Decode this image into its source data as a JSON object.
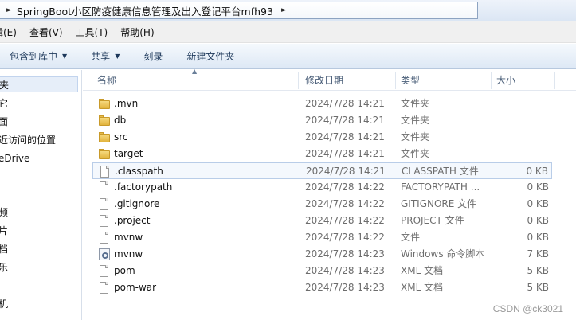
{
  "address": {
    "path": "SpringBoot小区防疫健康信息管理及出入登记平台mfh93"
  },
  "menu": [
    "辑(E)",
    "查看(V)",
    "工具(T)",
    "帮助(H)"
  ],
  "toolbar": {
    "include_library": "包含到库中",
    "share": "共享",
    "burn": "刻录",
    "new_folder": "新建文件夹"
  },
  "nav": [
    "夹",
    "它",
    "面",
    "近访问的位置",
    "eDrive",
    "频",
    "片",
    "档",
    "乐",
    "机"
  ],
  "columns": {
    "name": "名称",
    "date": "修改日期",
    "type": "类型",
    "size": "大小"
  },
  "files": [
    {
      "name": ".mvn",
      "date": "2024/7/28 14:21",
      "type": "文件夹",
      "size": "",
      "icon": "folder-icon"
    },
    {
      "name": "db",
      "date": "2024/7/28 14:21",
      "type": "文件夹",
      "size": "",
      "icon": "folder-icon"
    },
    {
      "name": "src",
      "date": "2024/7/28 14:21",
      "type": "文件夹",
      "size": "",
      "icon": "folder-icon"
    },
    {
      "name": "target",
      "date": "2024/7/28 14:21",
      "type": "文件夹",
      "size": "",
      "icon": "folder-icon"
    },
    {
      "name": ".classpath",
      "date": "2024/7/28 14:21",
      "type": "CLASSPATH 文件",
      "size": "0 KB",
      "icon": "file-icon"
    },
    {
      "name": ".factorypath",
      "date": "2024/7/28 14:22",
      "type": "FACTORYPATH ...",
      "size": "0 KB",
      "icon": "file-icon"
    },
    {
      "name": ".gitignore",
      "date": "2024/7/28 14:22",
      "type": "GITIGNORE 文件",
      "size": "0 KB",
      "icon": "file-icon"
    },
    {
      "name": ".project",
      "date": "2024/7/28 14:22",
      "type": "PROJECT 文件",
      "size": "0 KB",
      "icon": "file-icon"
    },
    {
      "name": "mvnw",
      "date": "2024/7/28 14:22",
      "type": "文件",
      "size": "0 KB",
      "icon": "file-icon"
    },
    {
      "name": "mvnw",
      "date": "2024/7/28 14:23",
      "type": "Windows 命令脚本",
      "size": "7 KB",
      "icon": "script-icon"
    },
    {
      "name": "pom",
      "date": "2024/7/28 14:23",
      "type": "XML 文档",
      "size": "5 KB",
      "icon": "file-icon"
    },
    {
      "name": "pom-war",
      "date": "2024/7/28 14:23",
      "type": "XML 文档",
      "size": "5 KB",
      "icon": "file-icon"
    }
  ],
  "watermark": "CSDN @ck3021"
}
